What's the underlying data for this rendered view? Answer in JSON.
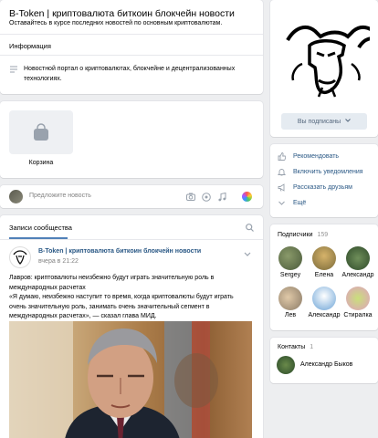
{
  "group": {
    "title": "B-Token | криптовалюта биткоин блокчейн новости",
    "status": "Оставайтесь в курсе последних новостей по основным криптовалютам.",
    "info_header": "Информация",
    "description": "Новостной портал о криптовалютах, блокчейне и децентрализованных технологиях."
  },
  "shop": {
    "item_label": "Корзина"
  },
  "composer": {
    "placeholder": "Предложите новость"
  },
  "wall": {
    "tab_label": "Записи сообщества",
    "post": {
      "author": "B-Token | криптовалюта биткоин блокчейн новости",
      "time": "вчера в 21:22",
      "text_line1": "Лавров: криптовалюты неизбежно будут играть значительную роль в международных расчетах",
      "text_line2": "«Я думаю, неизбежно наступит то время, когда криптовалюты будут играть очень значительную роль, занимать очень значительный сегмент в международных расчетах», — сказал глава МИД."
    }
  },
  "sidebar": {
    "subscribed_button": "Вы подписаны",
    "actions": [
      {
        "label": "Рекомендовать",
        "icon": "thumb-up-icon"
      },
      {
        "label": "Включить уведомления",
        "icon": "bell-icon"
      },
      {
        "label": "Рассказать друзьям",
        "icon": "megaphone-icon"
      },
      {
        "label": "Ещё",
        "icon": "chevron-down-icon"
      }
    ],
    "subscribers": {
      "title": "Подписчики",
      "count": "159",
      "people": [
        "Sergey",
        "Елена",
        "Александр",
        "Лев",
        "Александр",
        "Стиралка"
      ]
    },
    "contacts": {
      "title": "Контакты",
      "count": "1",
      "person": "Александр Быков"
    }
  },
  "colors": {
    "accent": "#2a5885",
    "muted": "#656565",
    "button_bg": "#e5ebf1"
  }
}
